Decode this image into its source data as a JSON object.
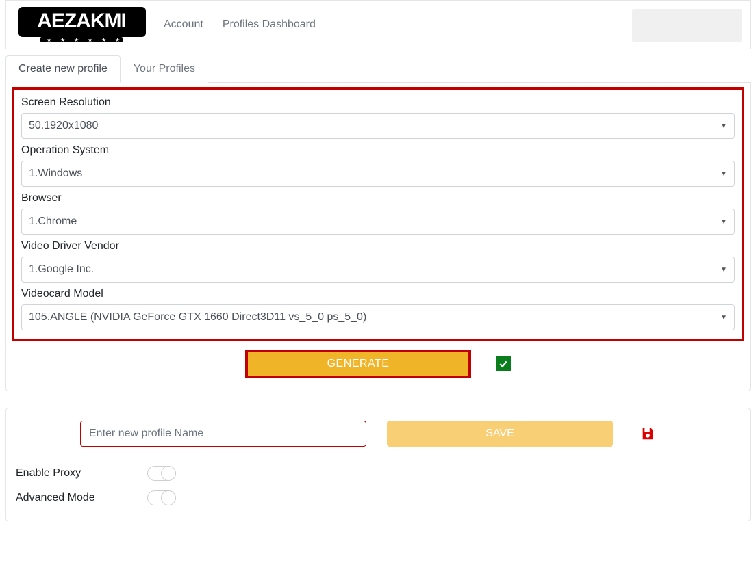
{
  "nav": {
    "account": "Account",
    "profiles_dashboard": "Profiles Dashboard"
  },
  "tabs": {
    "create": "Create new profile",
    "your": "Your Profiles"
  },
  "form": {
    "screen_resolution": {
      "label": "Screen Resolution",
      "value": "50.1920x1080"
    },
    "operation_system": {
      "label": "Operation System",
      "value": "1.Windows"
    },
    "browser": {
      "label": "Browser",
      "value": "1.Chrome"
    },
    "video_driver_vendor": {
      "label": "Video Driver Vendor",
      "value": "1.Google Inc."
    },
    "videocard_model": {
      "label": "Videocard Model",
      "value": "105.ANGLE (NVIDIA GeForce GTX 1660 Direct3D11 vs_5_0 ps_5_0)"
    }
  },
  "generate_button": "GENERATE",
  "save": {
    "placeholder": "Enter new profile Name",
    "value": "",
    "button": "SAVE"
  },
  "toggles": {
    "enable_proxy": "Enable Proxy",
    "advanced_mode": "Advanced Mode"
  }
}
